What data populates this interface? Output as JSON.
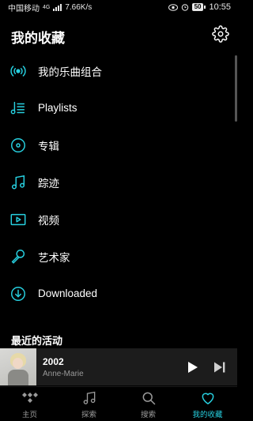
{
  "status_bar": {
    "carrier": "中国移动",
    "net_type": "4G",
    "speed": "7.66K/s",
    "battery": "50",
    "time": "10:55"
  },
  "header": {
    "title": "我的收藏",
    "settings_icon": "gear-icon"
  },
  "menu": [
    {
      "label": "我的乐曲组合",
      "icon": "radio-signal-icon"
    },
    {
      "label": "Playlists",
      "icon": "playlist-icon"
    },
    {
      "label": "专辑",
      "icon": "album-disc-icon"
    },
    {
      "label": "踪迹",
      "icon": "music-note-icon"
    },
    {
      "label": "视频",
      "icon": "video-play-icon"
    },
    {
      "label": "艺术家",
      "icon": "microphone-icon"
    },
    {
      "label": "Downloaded",
      "icon": "download-icon"
    }
  ],
  "recent": {
    "title": "最近的活动"
  },
  "player": {
    "track_title": "2002",
    "artist": "Anne-Marie"
  },
  "tabs": [
    {
      "label": "主页",
      "icon": "tidal-logo-icon",
      "active": false
    },
    {
      "label": "探索",
      "icon": "music-note-icon",
      "active": false
    },
    {
      "label": "搜索",
      "icon": "search-icon",
      "active": false
    },
    {
      "label": "我的收藏",
      "icon": "heart-icon",
      "active": true
    }
  ],
  "colors": {
    "accent": "#27d0e0",
    "background": "#000000",
    "player_background": "#1c1c1c",
    "inactive": "#9a9a9a"
  }
}
